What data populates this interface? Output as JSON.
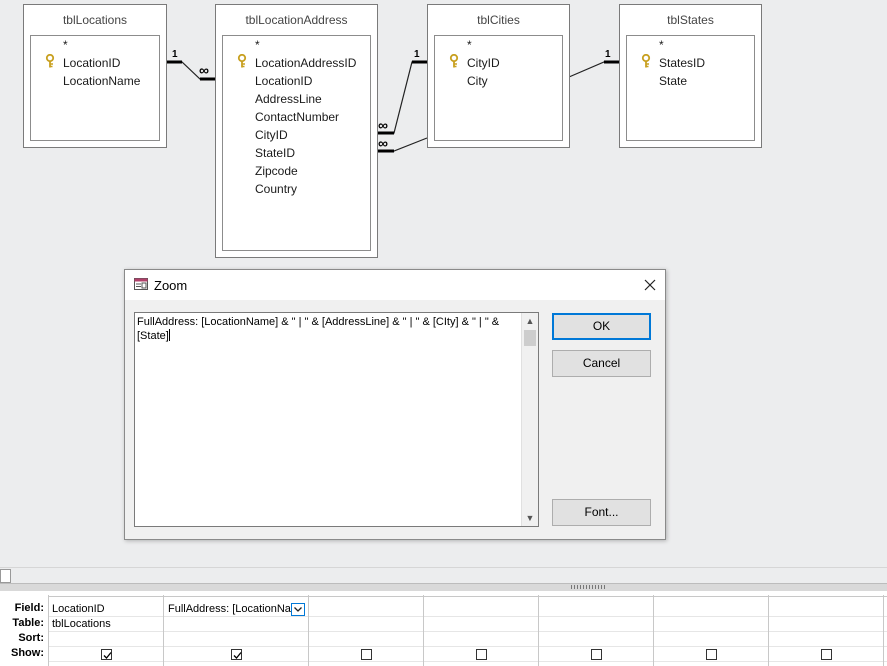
{
  "tables": [
    {
      "title": "tblLocations",
      "fields": [
        "*",
        "LocationID",
        "LocationName"
      ],
      "key_field": "LocationID"
    },
    {
      "title": "tblLocationAddress",
      "fields": [
        "*",
        "LocationAddressID",
        "LocationID",
        "AddressLine",
        "ContactNumber",
        "CityID",
        "StateID",
        "Zipcode",
        "Country"
      ],
      "key_field": "LocationAddressID"
    },
    {
      "title": "tblCities",
      "fields": [
        "*",
        "CityID",
        "City"
      ],
      "key_field": "CityID"
    },
    {
      "title": "tblStates",
      "fields": [
        "*",
        "StatesID",
        "State"
      ],
      "key_field": "StatesID"
    }
  ],
  "relationships": {
    "one_label": "1",
    "many_label": "∞"
  },
  "zoom_dialog": {
    "title": "Zoom",
    "close_icon": "close-icon",
    "expression": "FullAddress: [LocationName] & \" | \" & [AddressLine] & \" | \" & [CIty] & \" | \" &\n[State]",
    "ok_label": "OK",
    "cancel_label": "Cancel",
    "font_label": "Font..."
  },
  "grid": {
    "row_labels": {
      "field": "Field:",
      "table": "Table:",
      "sort": "Sort:",
      "show": "Show:"
    },
    "columns": [
      {
        "field": "LocationID",
        "table": "tblLocations",
        "show": true
      },
      {
        "field": "FullAddress: [LocationNa",
        "table": "",
        "show": true
      },
      {
        "field": "",
        "table": "",
        "show": false
      },
      {
        "field": "",
        "table": "",
        "show": false
      },
      {
        "field": "",
        "table": "",
        "show": false
      },
      {
        "field": "",
        "table": "",
        "show": false
      },
      {
        "field": "",
        "table": "",
        "show": false
      }
    ]
  },
  "colors": {
    "focus_blue": "#0078d7",
    "workspace": "#ecedee",
    "key_gold": "#c8a020"
  }
}
